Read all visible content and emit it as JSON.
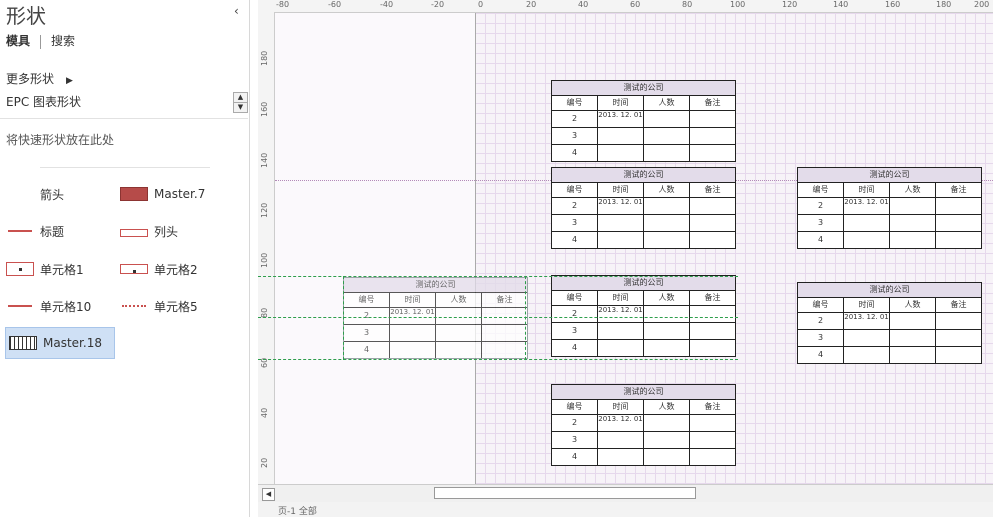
{
  "panel": {
    "title": "形状",
    "collapse_glyph": "‹",
    "tabs": [
      "模具",
      "搜索"
    ],
    "more_shapes": "更多形状",
    "more_arrow": "▶",
    "stencil": "EPC 图表形状",
    "quick_hint": "将快速形状放在此处",
    "shapes": [
      {
        "label": "箭头",
        "icon": "arrow-icon"
      },
      {
        "label": "Master.7",
        "icon": "master7-icon"
      },
      {
        "label": "标题",
        "icon": "title-icon"
      },
      {
        "label": "列头",
        "icon": "column-header-icon"
      },
      {
        "label": "单元格1",
        "icon": "cell1-icon"
      },
      {
        "label": "单元格2",
        "icon": "cell2-icon"
      },
      {
        "label": "单元格10",
        "icon": "cell10-icon"
      },
      {
        "label": "单元格5",
        "icon": "cell5-icon"
      },
      {
        "label": "Master.18",
        "icon": "master18-icon"
      }
    ]
  },
  "ruler": {
    "top": [
      "-80",
      "-60",
      "-40",
      "-20",
      "0",
      "20",
      "40",
      "60",
      "80",
      "100",
      "120",
      "140",
      "160",
      "180",
      "200"
    ],
    "left": [
      "180",
      "160",
      "140",
      "120",
      "100",
      "80",
      "60",
      "40",
      "20"
    ]
  },
  "table": {
    "title": "测试的公司",
    "headers": [
      "编号",
      "时间",
      "人数",
      "备注"
    ],
    "rows": [
      [
        "2",
        "2013. 12. 01",
        "",
        ""
      ],
      [
        "3",
        "",
        "",
        ""
      ],
      [
        "4",
        "",
        "",
        ""
      ]
    ]
  },
  "status": "页-1    全部"
}
